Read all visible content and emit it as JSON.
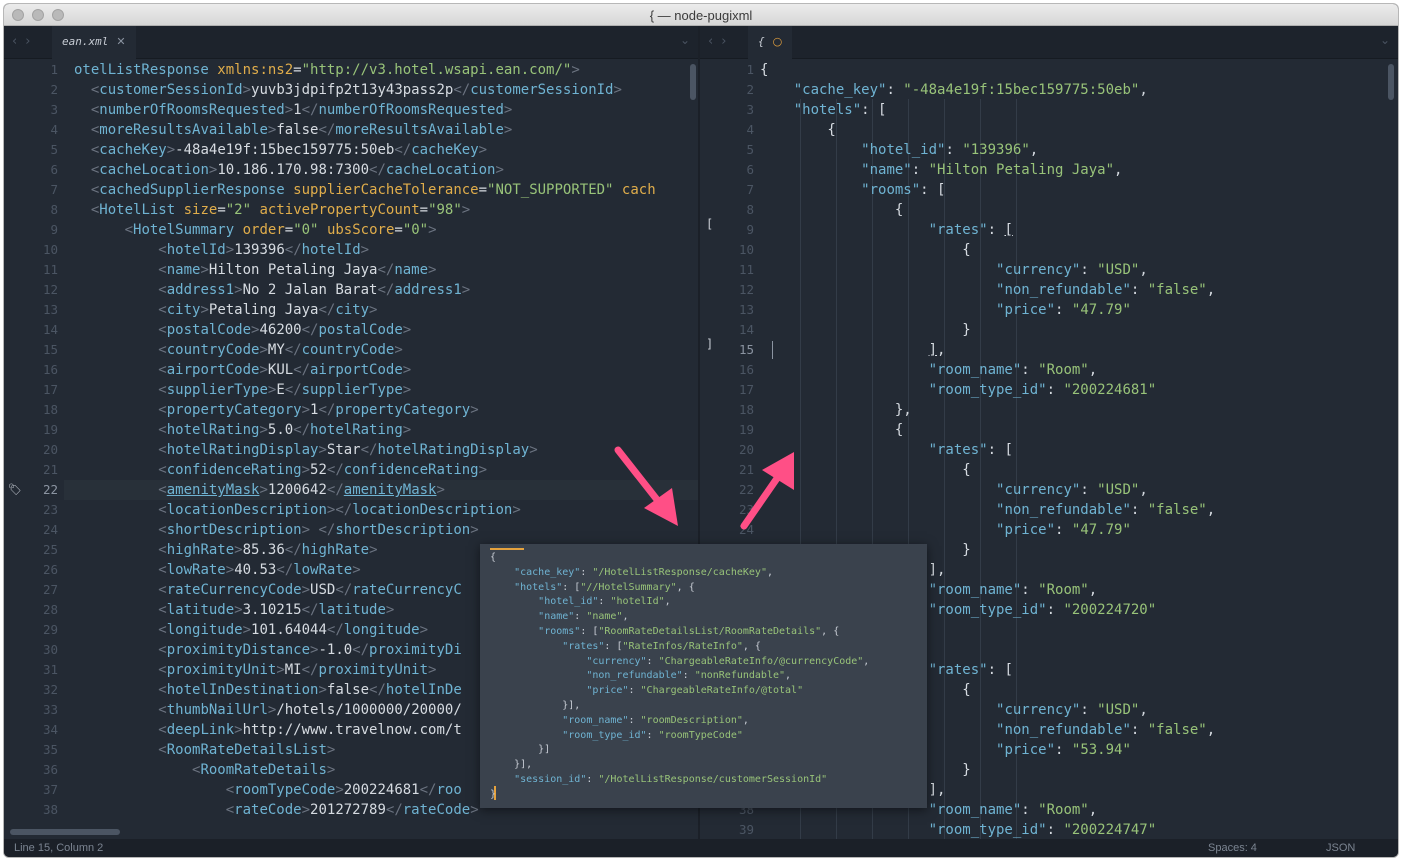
{
  "window": {
    "title": "{ — node-pugixml"
  },
  "left_tab": {
    "label": "ean.xml",
    "close": "✕"
  },
  "right_tab": {
    "label": "{",
    "dirty": "○"
  },
  "left_lines": [
    {
      "n": "1",
      "h": "<span class=\"t\">otelListResponse</span> <span class=\"a\">xmlns:ns2</span>=<span class=\"s\">\"http://v3.hotel.wsapi.ean.com/\"</span><span class=\"p\">&gt;</span>"
    },
    {
      "n": "2",
      "h": "  <span class=\"p\">&lt;</span><span class=\"t\">customerSessionId</span><span class=\"p\">&gt;</span>yuvb3jdpifp2t13y43pass2p<span class=\"p\">&lt;/</span><span class=\"t\">customerSessionId</span><span class=\"p\">&gt;</span>"
    },
    {
      "n": "3",
      "h": "  <span class=\"p\">&lt;</span><span class=\"t\">numberOfRoomsRequested</span><span class=\"p\">&gt;</span>1<span class=\"p\">&lt;/</span><span class=\"t\">numberOfRoomsRequested</span><span class=\"p\">&gt;</span>"
    },
    {
      "n": "4",
      "h": "  <span class=\"p\">&lt;</span><span class=\"t\">moreResultsAvailable</span><span class=\"p\">&gt;</span>false<span class=\"p\">&lt;/</span><span class=\"t\">moreResultsAvailable</span><span class=\"p\">&gt;</span>"
    },
    {
      "n": "5",
      "h": "  <span class=\"p\">&lt;</span><span class=\"t\">cacheKey</span><span class=\"p\">&gt;</span>-48a4e19f:15bec159775:50eb<span class=\"p\">&lt;/</span><span class=\"t\">cacheKey</span><span class=\"p\">&gt;</span>"
    },
    {
      "n": "6",
      "h": "  <span class=\"p\">&lt;</span><span class=\"t\">cacheLocation</span><span class=\"p\">&gt;</span>10.186.170.98:7300<span class=\"p\">&lt;/</span><span class=\"t\">cacheLocation</span><span class=\"p\">&gt;</span>"
    },
    {
      "n": "7",
      "h": "  <span class=\"p\">&lt;</span><span class=\"t\">cachedSupplierResponse</span> <span class=\"a\">supplierCacheTolerance</span>=<span class=\"s\">\"NOT_SUPPORTED\"</span> <span class=\"a\">cach</span>"
    },
    {
      "n": "8",
      "h": "  <span class=\"p\">&lt;</span><span class=\"t\">HotelList</span> <span class=\"a\">size</span>=<span class=\"s\">\"2\"</span> <span class=\"a\">activePropertyCount</span>=<span class=\"s\">\"98\"</span><span class=\"p\">&gt;</span>"
    },
    {
      "n": "9",
      "h": "      <span class=\"p\">&lt;</span><span class=\"t\">HotelSummary</span> <span class=\"a\">order</span>=<span class=\"s\">\"0\"</span> <span class=\"a\">ubsScore</span>=<span class=\"s\">\"0\"</span><span class=\"p\">&gt;</span>"
    },
    {
      "n": "10",
      "h": "          <span class=\"p\">&lt;</span><span class=\"t\">hotelId</span><span class=\"p\">&gt;</span>139396<span class=\"p\">&lt;/</span><span class=\"t\">hotelId</span><span class=\"p\">&gt;</span>"
    },
    {
      "n": "11",
      "h": "          <span class=\"p\">&lt;</span><span class=\"t\">name</span><span class=\"p\">&gt;</span>Hilton Petaling Jaya<span class=\"p\">&lt;/</span><span class=\"t\">name</span><span class=\"p\">&gt;</span>"
    },
    {
      "n": "12",
      "h": "          <span class=\"p\">&lt;</span><span class=\"t\">address1</span><span class=\"p\">&gt;</span>No 2 Jalan Barat<span class=\"p\">&lt;/</span><span class=\"t\">address1</span><span class=\"p\">&gt;</span>"
    },
    {
      "n": "13",
      "h": "          <span class=\"p\">&lt;</span><span class=\"t\">city</span><span class=\"p\">&gt;</span>Petaling Jaya<span class=\"p\">&lt;/</span><span class=\"t\">city</span><span class=\"p\">&gt;</span>"
    },
    {
      "n": "14",
      "h": "          <span class=\"p\">&lt;</span><span class=\"t\">postalCode</span><span class=\"p\">&gt;</span>46200<span class=\"p\">&lt;/</span><span class=\"t\">postalCode</span><span class=\"p\">&gt;</span>"
    },
    {
      "n": "15",
      "h": "          <span class=\"p\">&lt;</span><span class=\"t\">countryCode</span><span class=\"p\">&gt;</span>MY<span class=\"p\">&lt;/</span><span class=\"t\">countryCode</span><span class=\"p\">&gt;</span>"
    },
    {
      "n": "16",
      "h": "          <span class=\"p\">&lt;</span><span class=\"t\">airportCode</span><span class=\"p\">&gt;</span>KUL<span class=\"p\">&lt;/</span><span class=\"t\">airportCode</span><span class=\"p\">&gt;</span>"
    },
    {
      "n": "17",
      "h": "          <span class=\"p\">&lt;</span><span class=\"t\">supplierType</span><span class=\"p\">&gt;</span>E<span class=\"p\">&lt;/</span><span class=\"t\">supplierType</span><span class=\"p\">&gt;</span>"
    },
    {
      "n": "18",
      "h": "          <span class=\"p\">&lt;</span><span class=\"t\">propertyCategory</span><span class=\"p\">&gt;</span>1<span class=\"p\">&lt;/</span><span class=\"t\">propertyCategory</span><span class=\"p\">&gt;</span>"
    },
    {
      "n": "19",
      "h": "          <span class=\"p\">&lt;</span><span class=\"t\">hotelRating</span><span class=\"p\">&gt;</span>5.0<span class=\"p\">&lt;/</span><span class=\"t\">hotelRating</span><span class=\"p\">&gt;</span>"
    },
    {
      "n": "20",
      "h": "          <span class=\"p\">&lt;</span><span class=\"t\">hotelRatingDisplay</span><span class=\"p\">&gt;</span>Star<span class=\"p\">&lt;/</span><span class=\"t\">hotelRatingDisplay</span><span class=\"p\">&gt;</span>"
    },
    {
      "n": "21",
      "h": "          <span class=\"p\">&lt;</span><span class=\"t\">confidenceRating</span><span class=\"p\">&gt;</span>52<span class=\"p\">&lt;/</span><span class=\"t\">confidenceRating</span><span class=\"p\">&gt;</span>"
    },
    {
      "n": "22",
      "h": "          <span class=\"p\">&lt;</span><span class=\"t\" style=\"text-decoration:underline\">amenityMask</span><span class=\"p\">&gt;</span>1200642<span class=\"p\">&lt;/</span><span class=\"t\" style=\"text-decoration:underline\">amenityMask</span><span class=\"p\">&gt;</span>"
    },
    {
      "n": "23",
      "h": "          <span class=\"p\">&lt;</span><span class=\"t\">locationDescription</span><span class=\"p\">&gt;&lt;/</span><span class=\"t\">locationDescription</span><span class=\"p\">&gt;</span>"
    },
    {
      "n": "24",
      "h": "          <span class=\"p\">&lt;</span><span class=\"t\">shortDescription</span><span class=\"p\">&gt;</span> <span class=\"p\">&lt;/</span><span class=\"t\">shortDescription</span><span class=\"p\">&gt;</span>"
    },
    {
      "n": "25",
      "h": "          <span class=\"p\">&lt;</span><span class=\"t\">highRate</span><span class=\"p\">&gt;</span>85.36<span class=\"p\">&lt;/</span><span class=\"t\">highRate</span><span class=\"p\">&gt;</span>"
    },
    {
      "n": "26",
      "h": "          <span class=\"p\">&lt;</span><span class=\"t\">lowRate</span><span class=\"p\">&gt;</span>40.53<span class=\"p\">&lt;/</span><span class=\"t\">lowRate</span><span class=\"p\">&gt;</span>"
    },
    {
      "n": "27",
      "h": "          <span class=\"p\">&lt;</span><span class=\"t\">rateCurrencyCode</span><span class=\"p\">&gt;</span>USD<span class=\"p\">&lt;/</span><span class=\"t\">rateCurrencyC</span>"
    },
    {
      "n": "28",
      "h": "          <span class=\"p\">&lt;</span><span class=\"t\">latitude</span><span class=\"p\">&gt;</span>3.10215<span class=\"p\">&lt;/</span><span class=\"t\">latitude</span><span class=\"p\">&gt;</span>"
    },
    {
      "n": "29",
      "h": "          <span class=\"p\">&lt;</span><span class=\"t\">longitude</span><span class=\"p\">&gt;</span>101.64044<span class=\"p\">&lt;/</span><span class=\"t\">longitude</span><span class=\"p\">&gt;</span>"
    },
    {
      "n": "30",
      "h": "          <span class=\"p\">&lt;</span><span class=\"t\">proximityDistance</span><span class=\"p\">&gt;</span>-1.0<span class=\"p\">&lt;/</span><span class=\"t\">proximityDi</span>"
    },
    {
      "n": "31",
      "h": "          <span class=\"p\">&lt;</span><span class=\"t\">proximityUnit</span><span class=\"p\">&gt;</span>MI<span class=\"p\">&lt;/</span><span class=\"t\">proximityUnit</span><span class=\"p\">&gt;</span>"
    },
    {
      "n": "32",
      "h": "          <span class=\"p\">&lt;</span><span class=\"t\">hotelInDestination</span><span class=\"p\">&gt;</span>false<span class=\"p\">&lt;/</span><span class=\"t\">hotelInDe</span>"
    },
    {
      "n": "33",
      "h": "          <span class=\"p\">&lt;</span><span class=\"t\">thumbNailUrl</span><span class=\"p\">&gt;</span>/hotels/1000000/20000/"
    },
    {
      "n": "34",
      "h": "          <span class=\"p\">&lt;</span><span class=\"t\">deepLink</span><span class=\"p\">&gt;</span>http://www.travelnow.com/t"
    },
    {
      "n": "35",
      "h": "          <span class=\"p\">&lt;</span><span class=\"t\">RoomRateDetailsList</span><span class=\"p\">&gt;</span>"
    },
    {
      "n": "36",
      "h": "              <span class=\"p\">&lt;</span><span class=\"t\">RoomRateDetails</span><span class=\"p\">&gt;</span>"
    },
    {
      "n": "37",
      "h": "                  <span class=\"p\">&lt;</span><span class=\"t\">roomTypeCode</span><span class=\"p\">&gt;</span>200224681<span class=\"p\">&lt;/</span><span class=\"t\">roo</span>"
    },
    {
      "n": "38",
      "h": "                  <span class=\"p\">&lt;</span><span class=\"t\">rateCode</span><span class=\"p\">&gt;</span>201272789<span class=\"p\">&lt;/</span><span class=\"t\">rateCode</span><span class=\"p\">&gt;</span>"
    }
  ],
  "right_lines": [
    {
      "n": "1",
      "h": "{"
    },
    {
      "n": "2",
      "h": "    <span class=\"k\">\"cache_key\"</span>: <span class=\"s\">\"-48a4e19f:15bec159775:50eb\"</span>,"
    },
    {
      "n": "3",
      "h": "    <span class=\"k\">\"hotels\"</span>: ["
    },
    {
      "n": "4",
      "h": "        {"
    },
    {
      "n": "5",
      "h": "            <span class=\"k\">\"hotel_id\"</span>: <span class=\"s\">\"139396\"</span>,"
    },
    {
      "n": "6",
      "h": "            <span class=\"k\">\"name\"</span>: <span class=\"s\">\"Hilton Petaling Jaya\"</span>,"
    },
    {
      "n": "7",
      "h": "            <span class=\"k\">\"rooms\"</span>: ["
    },
    {
      "n": "8",
      "h": "                {"
    },
    {
      "n": "9",
      "h": "                    <span class=\"k\">\"rates\"</span>: <span style=\"text-decoration:underline\">[</span>"
    },
    {
      "n": "10",
      "h": "                        {"
    },
    {
      "n": "11",
      "h": "                            <span class=\"k\">\"currency\"</span>: <span class=\"s\">\"USD\"</span>,"
    },
    {
      "n": "12",
      "h": "                            <span class=\"k\">\"non_refundable\"</span>: <span class=\"s\">\"false\"</span>,"
    },
    {
      "n": "13",
      "h": "                            <span class=\"k\">\"price\"</span>: <span class=\"s\">\"47.79\"</span>"
    },
    {
      "n": "14",
      "h": "                        }"
    },
    {
      "n": "15",
      "h": "                    <span style=\"text-decoration:underline\">]</span>,"
    },
    {
      "n": "16",
      "h": "                    <span class=\"k\">\"room_name\"</span>: <span class=\"s\">\"Room\"</span>,"
    },
    {
      "n": "17",
      "h": "                    <span class=\"k\">\"room_type_id\"</span>: <span class=\"s\">\"200224681\"</span>"
    },
    {
      "n": "18",
      "h": "                },"
    },
    {
      "n": "19",
      "h": "                {"
    },
    {
      "n": "20",
      "h": "                    <span class=\"k\">\"rates\"</span>: ["
    },
    {
      "n": "21",
      "h": "                        {"
    },
    {
      "n": "22",
      "h": "                            <span class=\"k\">\"currency\"</span>: <span class=\"s\">\"USD\"</span>,"
    },
    {
      "n": "23",
      "h": "                            <span class=\"k\">\"non_refundable\"</span>: <span class=\"s\">\"false\"</span>,"
    },
    {
      "n": "24",
      "h": "                            <span class=\"k\">\"price\"</span>: <span class=\"s\">\"47.79\"</span>"
    },
    {
      "n": "25",
      "h": "                        }"
    },
    {
      "n": "26",
      "h": "                    ],"
    },
    {
      "n": "27",
      "h": "                    <span class=\"k\">\"room_name\"</span>: <span class=\"s\">\"Room\"</span>,"
    },
    {
      "n": "28",
      "h": "                    <span class=\"k\">\"room_type_id\"</span>: <span class=\"s\">\"200224720\"</span>"
    },
    {
      "n": "29",
      "h": "                },"
    },
    {
      "n": "30",
      "h": "                {"
    },
    {
      "n": "31",
      "h": "                    <span class=\"k\">\"rates\"</span>: ["
    },
    {
      "n": "32",
      "h": "                        {"
    },
    {
      "n": "33",
      "h": "                            <span class=\"k\">\"currency\"</span>: <span class=\"s\">\"USD\"</span>,"
    },
    {
      "n": "34",
      "h": "                            <span class=\"k\">\"non_refundable\"</span>: <span class=\"s\">\"false\"</span>,"
    },
    {
      "n": "35",
      "h": "                            <span class=\"k\">\"price\"</span>: <span class=\"s\">\"53.94\"</span>"
    },
    {
      "n": "36",
      "h": "                        }"
    },
    {
      "n": "37",
      "h": "                    ],"
    },
    {
      "n": "38",
      "h": "                    <span class=\"k\">\"room_name\"</span>: <span class=\"s\">\"Room\"</span>,"
    },
    {
      "n": "39",
      "h": "                    <span class=\"k\">\"room_type_id\"</span>: <span class=\"s\">\"200224747\"</span>"
    }
  ],
  "popup_lines": [
    "{",
    "    <span class=\"k\">\"cache_key\"</span>: <span class=\"s\">\"/HotelListResponse/cacheKey\"</span>,",
    "    <span class=\"k\">\"hotels\"</span>: [<span class=\"s\">\"//HotelSummary\"</span>, {",
    "        <span class=\"k\">\"hotel_id\"</span>: <span class=\"s\">\"hotelId\"</span>,",
    "        <span class=\"k\">\"name\"</span>: <span class=\"s\">\"name\"</span>,",
    "        <span class=\"k\">\"rooms\"</span>: [<span class=\"s\">\"RoomRateDetailsList/RoomRateDetails\"</span>, {",
    "            <span class=\"k\">\"rates\"</span>: [<span class=\"s\">\"RateInfos/RateInfo\"</span>, {",
    "                <span class=\"k\">\"currency\"</span>: <span class=\"s\">\"ChargeableRateInfo/@currencyCode\"</span>,",
    "                <span class=\"k\">\"non_refundable\"</span>: <span class=\"s\">\"nonRefundable\"</span>,",
    "                <span class=\"k\">\"price\"</span>: <span class=\"s\">\"ChargeableRateInfo/@total\"</span>",
    "            }],",
    "            <span class=\"k\">\"room_name\"</span>: <span class=\"s\">\"roomDescription\"</span>,",
    "            <span class=\"k\">\"room_type_id\"</span>: <span class=\"s\">\"roomTypeCode\"</span>",
    "        }]",
    "    }],",
    "    <span class=\"k\">\"session_id\"</span>: <span class=\"s\">\"/HotelListResponse/customerSessionId\"</span>",
    "}"
  ],
  "right_gutter": {
    "open_bracket": "[",
    "close_bracket": "]"
  },
  "status": {
    "position": "Line 15, Column 2",
    "spaces": "Spaces: 4",
    "syntax": "JSON"
  },
  "colors": {
    "annotation_arrow": "#ff4f86"
  },
  "icons": {
    "nav_back": "chevron-left-icon",
    "nav_forward": "chevron-right-icon",
    "tab_menu": "chevron-down-icon",
    "bookmark": "tag-icon"
  }
}
